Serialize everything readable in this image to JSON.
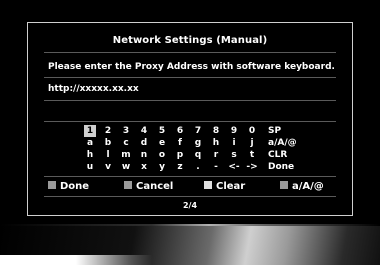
{
  "dialog": {
    "title": "Network Settings (Manual)",
    "prompt": "Please enter the Proxy Address with software keyboard.",
    "input_value": "http://xxxxx.xx.xx"
  },
  "keyboard": {
    "selected": "1",
    "rows": [
      [
        "1",
        "2",
        "3",
        "4",
        "5",
        "6",
        "7",
        "8",
        "9",
        "0",
        "SP"
      ],
      [
        "a",
        "b",
        "c",
        "d",
        "e",
        "f",
        "g",
        "h",
        "i",
        "j",
        "a/A/@"
      ],
      [
        "h",
        "l",
        "m",
        "n",
        "o",
        "p",
        "q",
        "r",
        "s",
        "t",
        "CLR"
      ],
      [
        "u",
        "v",
        "w",
        "x",
        "y",
        "z",
        ".",
        "-",
        "<-",
        "->",
        "Done"
      ]
    ]
  },
  "legend": {
    "done": {
      "label": "Done",
      "color": "#9a9a9a"
    },
    "cancel": {
      "label": "Cancel",
      "color": "#9a9a9a"
    },
    "clear": {
      "label": "Clear",
      "color": "#e0e0e0"
    },
    "mode": {
      "label": "a/A/@",
      "color": "#9a9a9a"
    }
  },
  "page_indicator": "2/4"
}
